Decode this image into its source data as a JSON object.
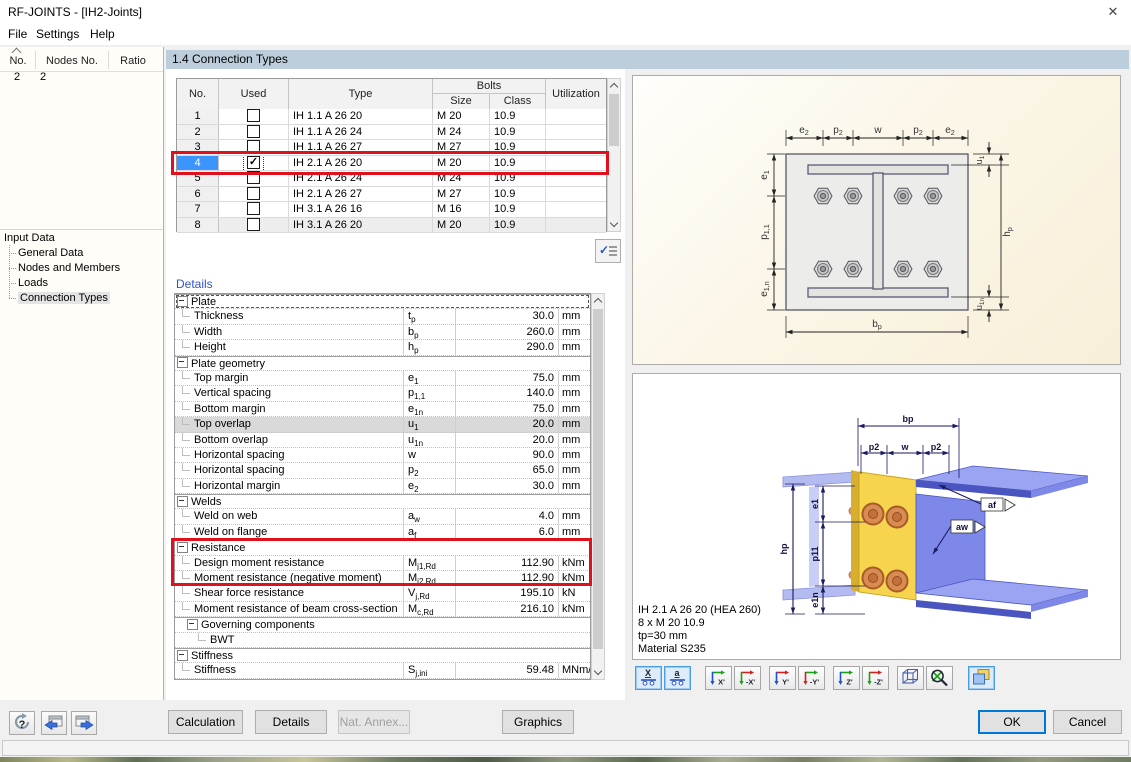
{
  "window": {
    "title": "RF-JOINTS - [IH2-Joints]",
    "close_glyph": "✕"
  },
  "menu": {
    "items": [
      "File",
      "Settings",
      "Help"
    ]
  },
  "nav_table": {
    "columns": [
      "No.",
      "Nodes No.",
      "Ratio"
    ],
    "rows": [
      {
        "no": "2",
        "nodes": "2",
        "ratio": ""
      }
    ]
  },
  "nav_tree": {
    "root": "Input Data",
    "items": [
      {
        "label": "General Data",
        "selected": false
      },
      {
        "label": "Nodes and Members",
        "selected": false
      },
      {
        "label": "Loads",
        "selected": false
      },
      {
        "label": "Connection Types",
        "selected": true
      }
    ]
  },
  "section": {
    "title": "1.4 Connection Types"
  },
  "conn_table": {
    "headers": {
      "no": "No.",
      "used": "Used",
      "type": "Type",
      "bolts": "Bolts",
      "size": "Size",
      "class": "Class",
      "utilization": "Utilization"
    },
    "rows": [
      {
        "no": "1",
        "used": false,
        "type": "IH 1.1 A 26 20",
        "size": "M 20",
        "class": "10.9",
        "utilization": "",
        "selected": false
      },
      {
        "no": "2",
        "used": false,
        "type": "IH 1.1 A 26 24",
        "size": "M 24",
        "class": "10.9",
        "utilization": "",
        "selected": false
      },
      {
        "no": "3",
        "used": false,
        "type": "IH 1.1 A 26 27",
        "size": "M 27",
        "class": "10.9",
        "utilization": "",
        "selected": false
      },
      {
        "no": "4",
        "used": true,
        "type": "IH 2.1 A 26 20",
        "size": "M 20",
        "class": "10.9",
        "utilization": "",
        "selected": true
      },
      {
        "no": "5",
        "used": false,
        "type": "IH 2.1 A 26 24",
        "size": "M 24",
        "class": "10.9",
        "utilization": "",
        "selected": false
      },
      {
        "no": "6",
        "used": false,
        "type": "IH 2.1 A 26 27",
        "size": "M 27",
        "class": "10.9",
        "utilization": "",
        "selected": false
      },
      {
        "no": "7",
        "used": false,
        "type": "IH 3.1 A 26 16",
        "size": "M 16",
        "class": "10.9",
        "utilization": "",
        "selected": false
      },
      {
        "no": "8",
        "used": false,
        "type": "IH 3.1 A 26 20",
        "size": "M 20",
        "class": "10.9",
        "utilization": "",
        "selected": false
      }
    ]
  },
  "details": {
    "title": "Details",
    "rows": [
      {
        "kind": "group",
        "label": "Plate",
        "focused": true
      },
      {
        "kind": "item",
        "label": "Thickness",
        "sym_m": "t",
        "sym_s": "p",
        "value": "30.0",
        "unit": "mm"
      },
      {
        "kind": "item",
        "label": "Width",
        "sym_m": "b",
        "sym_s": "p",
        "value": "260.0",
        "unit": "mm"
      },
      {
        "kind": "item",
        "label": "Height",
        "sym_m": "h",
        "sym_s": "p",
        "value": "290.0",
        "unit": "mm"
      },
      {
        "kind": "group",
        "label": "Plate geometry"
      },
      {
        "kind": "item",
        "label": "Top margin",
        "sym_m": "e",
        "sym_s": "1",
        "value": "75.0",
        "unit": "mm"
      },
      {
        "kind": "item",
        "label": "Vertical spacing",
        "sym_m": "p",
        "sym_s": "1,1",
        "value": "140.0",
        "unit": "mm"
      },
      {
        "kind": "item",
        "label": "Bottom margin",
        "sym_m": "e",
        "sym_s": "1n",
        "value": "75.0",
        "unit": "mm"
      },
      {
        "kind": "item",
        "label": "Top overlap",
        "sym_m": "u",
        "sym_s": "1",
        "value": "20.0",
        "unit": "mm",
        "selected": true
      },
      {
        "kind": "item",
        "label": "Bottom overlap",
        "sym_m": "u",
        "sym_s": "1n",
        "value": "20.0",
        "unit": "mm"
      },
      {
        "kind": "item",
        "label": "Horizontal spacing",
        "sym_m": "w",
        "sym_s": "",
        "value": "90.0",
        "unit": "mm"
      },
      {
        "kind": "item",
        "label": "Horizontal spacing",
        "sym_m": "p",
        "sym_s": "2",
        "value": "65.0",
        "unit": "mm"
      },
      {
        "kind": "item",
        "label": "Horizontal margin",
        "sym_m": "e",
        "sym_s": "2",
        "value": "30.0",
        "unit": "mm"
      },
      {
        "kind": "group",
        "label": "Welds"
      },
      {
        "kind": "item",
        "label": "Weld on web",
        "sym_m": "a",
        "sym_s": "w",
        "value": "4.0",
        "unit": "mm"
      },
      {
        "kind": "item",
        "label": "Weld on flange",
        "sym_m": "a",
        "sym_s": "f",
        "value": "6.0",
        "unit": "mm"
      },
      {
        "kind": "group",
        "label": "Resistance"
      },
      {
        "kind": "item",
        "label": "Design moment resistance",
        "sym_m": "M",
        "sym_s": "j1,Rd",
        "value": "112.90",
        "unit": "kNm"
      },
      {
        "kind": "item",
        "label": "Moment resistance (negative moment)",
        "sym_m": "M",
        "sym_s": "j2,Rd",
        "value": "112.90",
        "unit": "kNm"
      },
      {
        "kind": "item",
        "label": "Shear force resistance",
        "sym_m": "V",
        "sym_s": "j,Rd",
        "value": "195.10",
        "unit": "kN"
      },
      {
        "kind": "item",
        "label": "Moment resistance of beam cross-section",
        "sym_m": "M",
        "sym_s": "c,Rd",
        "value": "216.10",
        "unit": "kNm"
      },
      {
        "kind": "group2",
        "label": "Governing components"
      },
      {
        "kind": "item2",
        "label": "BWT"
      },
      {
        "kind": "group",
        "label": "Stiffness"
      },
      {
        "kind": "item",
        "label": "Stiffness",
        "sym_m": "S",
        "sym_s": "j,ini",
        "value": "59.48",
        "unit": "MNm/ra"
      }
    ]
  },
  "diagram2d": {
    "dims_top": [
      {
        "m": "e",
        "s": "2"
      },
      {
        "m": "p",
        "s": "2"
      },
      {
        "m": "w",
        "s": ""
      },
      {
        "m": "p",
        "s": "2"
      },
      {
        "m": "e",
        "s": "2"
      }
    ],
    "dims_left": [
      {
        "m": "e",
        "s": "1"
      },
      {
        "m": "p",
        "s": "1,1"
      },
      {
        "m": "e",
        "s": "1,n"
      }
    ],
    "dim_u1": {
      "m": "u",
      "s": "1"
    },
    "dim_hp": {
      "m": "h",
      "s": "p"
    },
    "dim_u1n": {
      "m": "u",
      "s": "1n"
    },
    "dim_bp": {
      "m": "b",
      "s": "p"
    }
  },
  "view3d": {
    "dims": {
      "bp": "bp",
      "p2_left": "p2",
      "w": "w",
      "p2_right": "p2",
      "hp": "hp",
      "e1": "e1",
      "p11": "p11",
      "e1n": "e1n",
      "af": "af",
      "aw": "aw"
    },
    "info_lines": [
      "IH 2.1 A 26 20  (HEA 260)",
      "8 x M 20 10.9",
      "tp=30 mm",
      "Material S235"
    ]
  },
  "view_toolbar": {
    "buttons": [
      {
        "name": "view-section-x",
        "label": "X",
        "icon": "support",
        "active": true
      },
      {
        "name": "view-section-a",
        "label": "a",
        "icon": "support",
        "active": true
      },
      {
        "name": "view-axis-x",
        "label": "X'",
        "icon": "axis",
        "active": false
      },
      {
        "name": "view-axis-minus-x",
        "label": "-X'",
        "icon": "axis",
        "active": false
      },
      {
        "name": "view-axis-y",
        "label": "Y'",
        "icon": "axis",
        "active": false
      },
      {
        "name": "view-axis-minus-y",
        "label": "-Y'",
        "icon": "axis",
        "active": false
      },
      {
        "name": "view-axis-z",
        "label": "Z'",
        "icon": "axis",
        "active": false
      },
      {
        "name": "view-axis-minus-z",
        "label": "-Z'",
        "icon": "axis",
        "active": false
      },
      {
        "name": "view-isometric",
        "label": "",
        "icon": "cube",
        "active": false
      },
      {
        "name": "zoom-off",
        "label": "",
        "icon": "zoom",
        "active": false
      },
      {
        "name": "layers",
        "label": "",
        "icon": "layers",
        "active": true
      }
    ]
  },
  "footer": {
    "calculation": "Calculation",
    "details": "Details",
    "nat_annex": "Nat. Annex...",
    "graphics": "Graphics",
    "ok": "OK",
    "cancel": "Cancel"
  },
  "statusbar": {
    "text": ""
  },
  "colors": {
    "annotation_red": "#e0111c",
    "selection_blue": "#3c94fd",
    "section_header": "#bccddb",
    "plate_yellow": "#f6d44e",
    "beam_blue": "#7d88e8",
    "bolt_orange": "#d4824e"
  }
}
